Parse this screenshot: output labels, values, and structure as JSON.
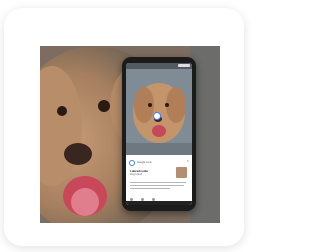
{
  "lens": {
    "header_label": "Google Lens",
    "close_icon": "close-icon",
    "result_title": "Labradoodle",
    "result_subtitle": "Dog breed",
    "actions": [
      "share-icon",
      "search-icon",
      "more-icon"
    ]
  },
  "colors": {
    "card_background": "#ffffff",
    "phone_frame": "#1b1b1b",
    "lens_accent": "#4285f4",
    "dog_fur": "#c69a73"
  }
}
